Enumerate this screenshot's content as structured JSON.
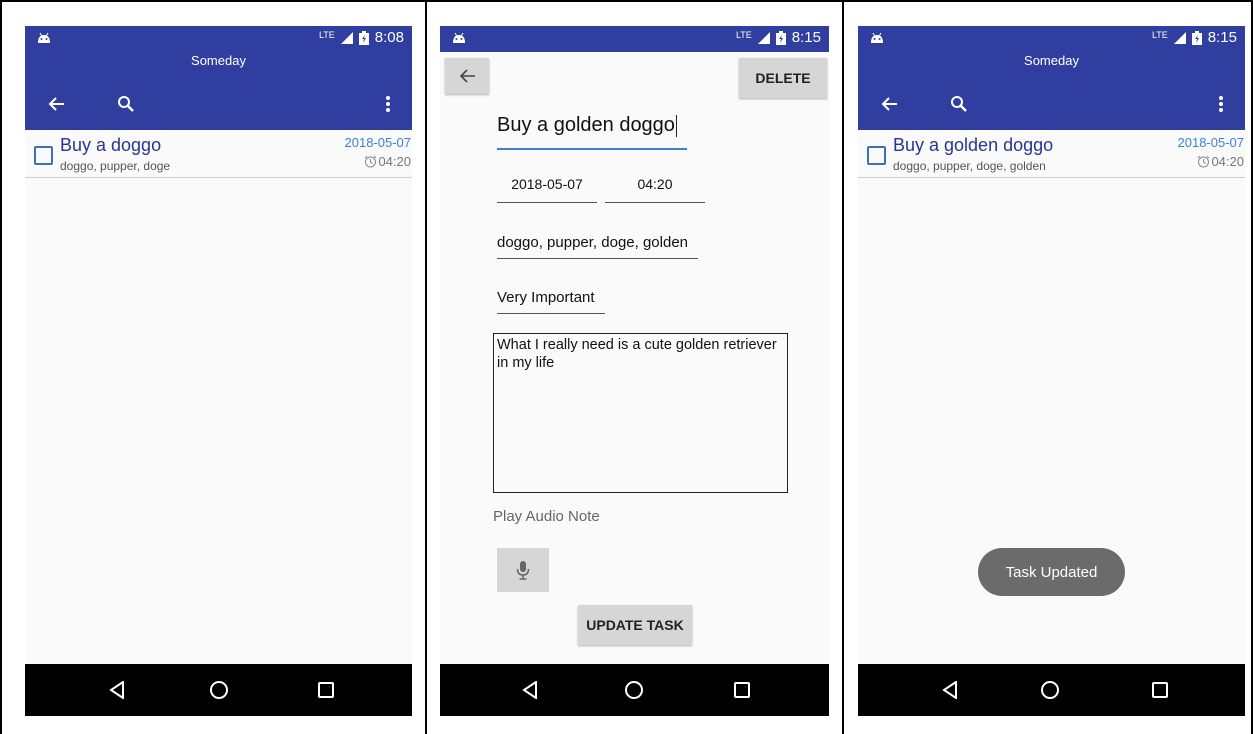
{
  "colors": {
    "primary": "#303f9f",
    "task_title": "#283593",
    "date_accent": "#3f80d6"
  },
  "screens": [
    {
      "status": {
        "network": "LTE",
        "time": "8:08"
      },
      "appbar": {
        "title": "Someday"
      },
      "task": {
        "title": "Buy a doggo",
        "tags": "doggo, pupper, doge",
        "date": "2018-05-07",
        "time": "04:20"
      }
    },
    {
      "status": {
        "network": "LTE",
        "time": "8:15"
      },
      "toolbar": {
        "delete_label": "DELETE"
      },
      "edit": {
        "title": "Buy a golden doggo",
        "date": "2018-05-07",
        "time": "04:20",
        "tags": "doggo, pupper, doge, golden",
        "priority": "Very Important",
        "note": "What I really need is a cute golden retriever in my life",
        "play_audio": "Play Audio Note",
        "update_label": "UPDATE TASK"
      }
    },
    {
      "status": {
        "network": "LTE",
        "time": "8:15"
      },
      "appbar": {
        "title": "Someday"
      },
      "task": {
        "title": "Buy a golden doggo",
        "tags": "doggo, pupper, doge, golden",
        "date": "2018-05-07",
        "time": "04:20"
      },
      "toast": "Task Updated"
    }
  ],
  "icons": {
    "back": "arrow-left-icon",
    "search": "search-icon",
    "overflow": "more-vert-icon",
    "alarm": "alarm-icon",
    "mic": "microphone-icon",
    "nav_back": "triangle-back-icon",
    "nav_home": "circle-home-icon",
    "nav_recents": "square-recents-icon"
  }
}
